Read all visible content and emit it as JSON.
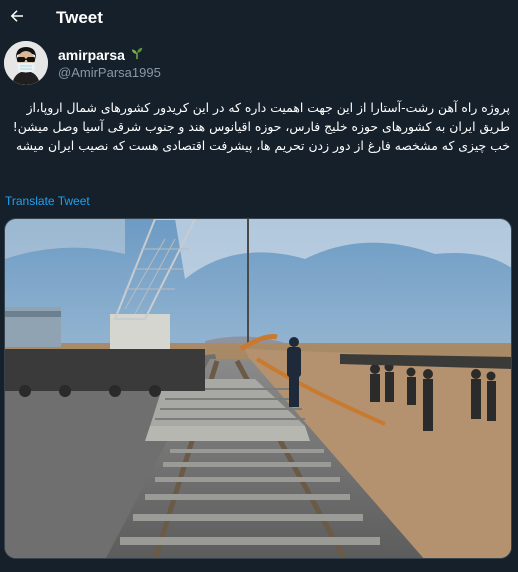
{
  "header": {
    "title": "Tweet",
    "back_icon": "arrow-left-icon"
  },
  "author": {
    "display_name": "amirparsa",
    "name_emoji": "seedling-icon",
    "handle": "@AmirParsa1995"
  },
  "tweet": {
    "lines": [
      "پروژه راه آهن رشت-آستارا از این جهت اهمیت داره که در این کریدور کشورهای شمال اروپا،از طریق ایران به کشورهای حوزه خلیج فارس، حوزه اقیانوس هند و جنوب شرقی آسیا وصل میشن!",
      "خب چیزی که مشخصه فارغ از دور زدن تحریم ها، پیشرفت اقتصادی هست که نصیب ایران میشه"
    ],
    "translate_label": "Translate Tweet"
  },
  "colors": {
    "background": "#15202b",
    "text": "#ffffff",
    "secondary": "#8899a6",
    "link": "#1da1f2"
  }
}
